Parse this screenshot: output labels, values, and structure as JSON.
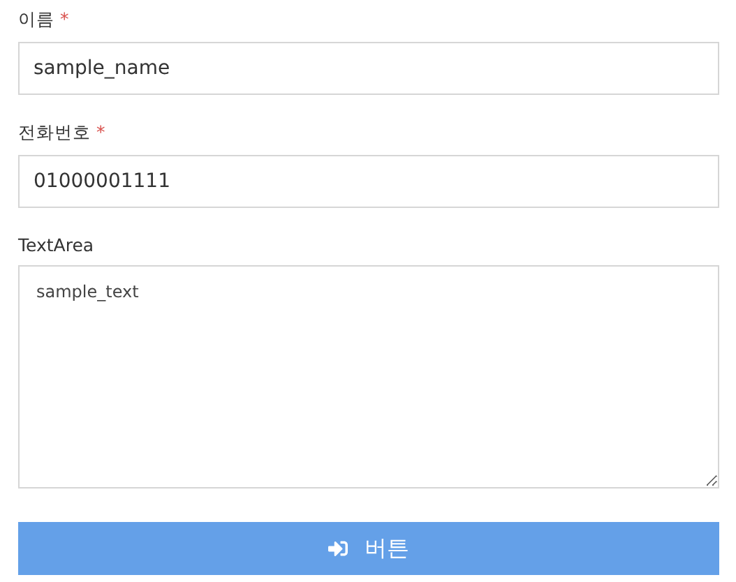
{
  "fields": [
    {
      "kind": "input",
      "label": "이름",
      "required_mark": "*",
      "value": "sample_name"
    },
    {
      "kind": "input",
      "label": "전화번호",
      "required_mark": "*",
      "value": "01000001111"
    },
    {
      "kind": "textarea",
      "label": "TextArea",
      "value": "sample_text"
    }
  ],
  "button": {
    "label": "버튼"
  }
}
